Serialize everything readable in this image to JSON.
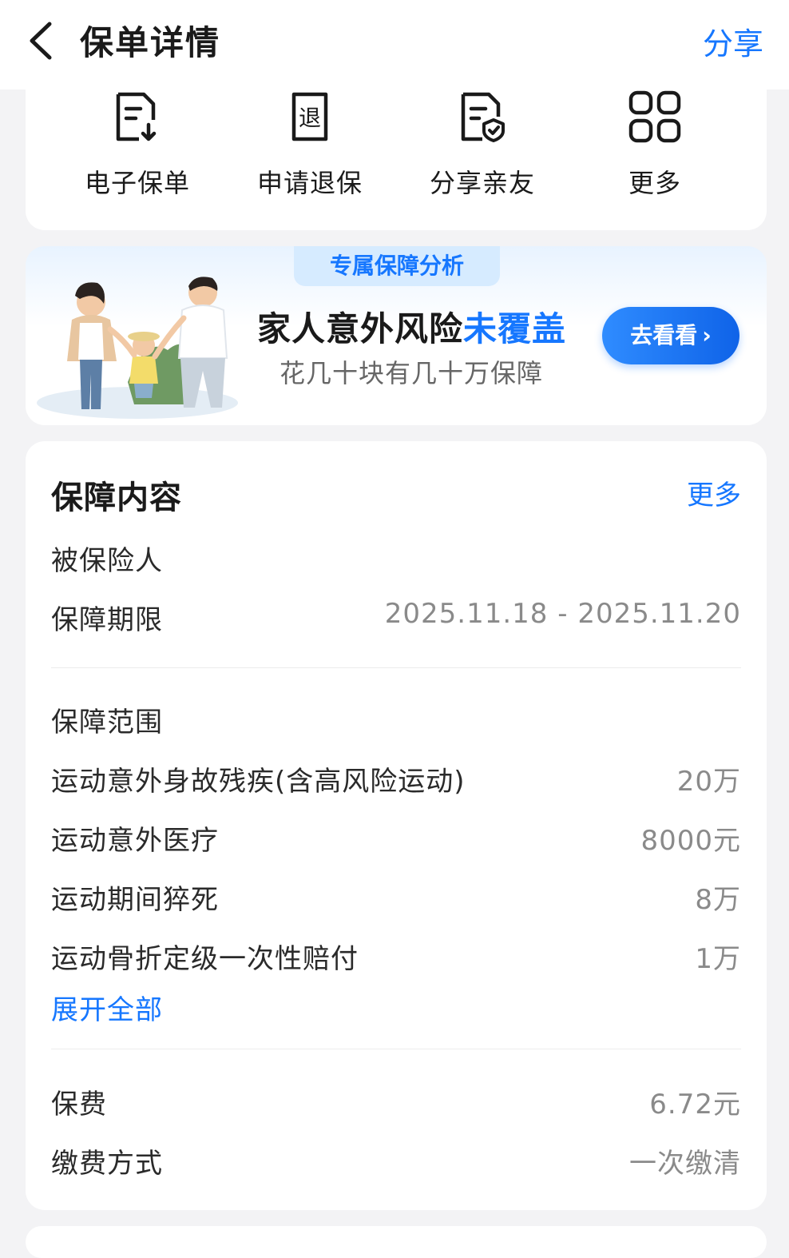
{
  "header": {
    "title": "保单详情",
    "share_label": "分享"
  },
  "actions": [
    {
      "label": "电子保单",
      "icon": "e-policy-doc-icon"
    },
    {
      "label": "申请退保",
      "icon": "refund-doc-icon"
    },
    {
      "label": "分享亲友",
      "icon": "shield-doc-icon"
    },
    {
      "label": "更多",
      "icon": "grid-icon"
    }
  ],
  "banner": {
    "tag": "专属保障分析",
    "title_plain": "家人意外风险",
    "title_highlight": "未覆盖",
    "subtitle": "花几十块有几十万保障",
    "cta_label": "去看看"
  },
  "coverage": {
    "title": "保障内容",
    "more_label": "更多",
    "insured_label": "被保险人",
    "insured_value": "",
    "period_label": "保障期限",
    "period_value": "2025.11.18 - 2025.11.20",
    "scope_label": "保障范围",
    "items": [
      {
        "name": "运动意外身故残疾(含高风险运动)",
        "amount": "20万"
      },
      {
        "name": "运动意外医疗",
        "amount": "8000元"
      },
      {
        "name": "运动期间猝死",
        "amount": "8万"
      },
      {
        "name": "运动骨折定级一次性赔付",
        "amount": "1万"
      }
    ],
    "expand_label": "展开全部",
    "premium_label": "保费",
    "premium_value": "6.72元",
    "payment_label": "缴费方式",
    "payment_value": "一次缴清"
  },
  "colors": {
    "accent": "#1677ff",
    "page_bg": "#f3f3f5",
    "muted": "#8a8a8a"
  }
}
